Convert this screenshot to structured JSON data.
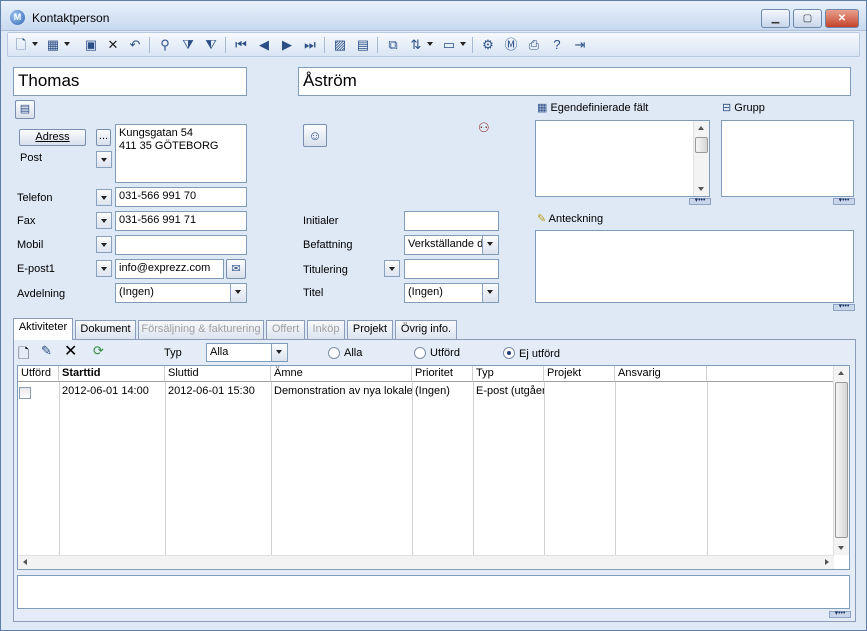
{
  "window": {
    "title": "Kontaktperson"
  },
  "name": {
    "first": "Thomas",
    "last": "Åström"
  },
  "address": {
    "button_label": "Adress",
    "more_label": "...",
    "type": "Post",
    "line1": "Kungsgatan 54",
    "line2": "411 35 GÖTEBORG"
  },
  "contact": {
    "phone_label": "Telefon",
    "phone": "031-566 991 70",
    "fax_label": "Fax",
    "fax": "031-566 991 71",
    "mobile_label": "Mobil",
    "mobile": "",
    "email_label": "E-post1",
    "email": "info@exprezz.com",
    "department_label": "Avdelning",
    "department": "(Ingen)"
  },
  "person": {
    "initials_label": "Initialer",
    "initials": "",
    "position_label": "Befattning",
    "position": "Verkställande d",
    "salutation_label": "Titulering",
    "salutation": "",
    "title_label": "Titel",
    "title": "(Ingen)"
  },
  "panels": {
    "custom_fields_label": "Egendefinierade fält",
    "group_label": "Grupp",
    "note_label": "Anteckning"
  },
  "tabs": [
    {
      "label": "Aktiviteter"
    },
    {
      "label": "Dokument"
    },
    {
      "label": "Försäljning & fakturering"
    },
    {
      "label": "Offert"
    },
    {
      "label": "Inköp"
    },
    {
      "label": "Projekt"
    },
    {
      "label": "Övrig info."
    }
  ],
  "activities": {
    "filter_label": "Typ",
    "filter_value": "Alla",
    "radio_all": "Alla",
    "radio_done": "Utförd",
    "radio_not_done": "Ej utförd",
    "columns": [
      "Utförd",
      "Starttid",
      "Sluttid",
      "Ämne",
      "Prioritet",
      "Typ",
      "Projekt",
      "Ansvarig"
    ],
    "rows": [
      {
        "start": "2012-06-01 14:00",
        "end": "2012-06-01 15:30",
        "subject": "Demonstration av nya lokaler",
        "priority": "(Ingen)",
        "type": "E-post (utgående)",
        "project": "",
        "responsible": ""
      }
    ]
  }
}
